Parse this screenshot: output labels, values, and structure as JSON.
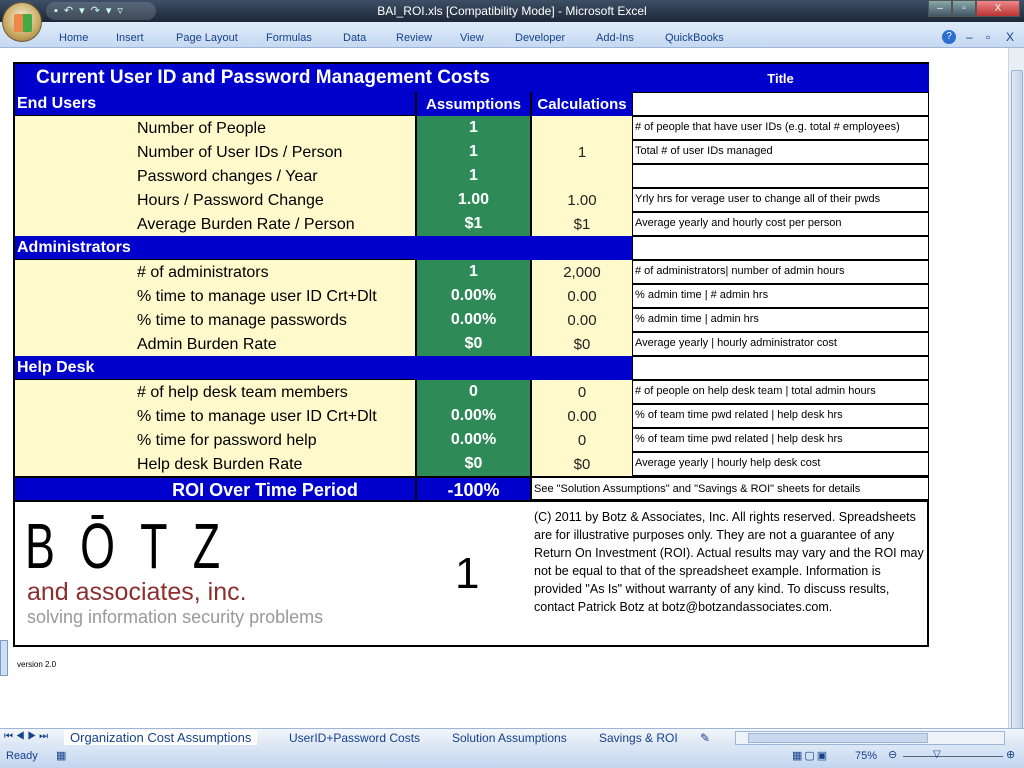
{
  "window": {
    "title": "BAI_ROI.xls  [Compatibility Mode] - Microsoft Excel"
  },
  "ribbon": {
    "tabs": [
      "Home",
      "Insert",
      "Page Layout",
      "Formulas",
      "Data",
      "Review",
      "View",
      "Developer",
      "Add-Ins",
      "QuickBooks"
    ]
  },
  "sheet": {
    "title": "Current User ID and Password Management Costs",
    "title_note": "Title",
    "col_assumptions": "Assumptions",
    "col_calculations": "Calculations",
    "sections": [
      {
        "name": "End Users",
        "rows": [
          {
            "label": "Number of People",
            "assumption": "1",
            "calc": "",
            "note": "# of people that have user IDs (e.g. total # employees)"
          },
          {
            "label": "Number of User IDs / Person",
            "assumption": "1",
            "calc": "1",
            "note": "Total # of user IDs managed"
          },
          {
            "label": "Password changes / Year",
            "assumption": "1",
            "calc": "",
            "note": ""
          },
          {
            "label": "Hours / Password Change",
            "assumption": "1.00",
            "calc": "1.00",
            "note": "Yrly hrs for verage user to change all of their pwds"
          },
          {
            "label": "Average Burden Rate / Person",
            "assumption": "$1",
            "calc": "$1",
            "note": "Average yearly and hourly cost per person"
          }
        ]
      },
      {
        "name": "Administrators",
        "rows": [
          {
            "label": "# of administrators",
            "assumption": "1",
            "calc": "2,000",
            "note": "# of administrators| number of admin hours"
          },
          {
            "label": "% time to manage user ID Crt+Dlt",
            "assumption": "0.00%",
            "calc": "0.00",
            "note": "% admin time |  # admin hrs"
          },
          {
            "label": "% time to manage passwords",
            "assumption": "0.00%",
            "calc": "0.00",
            "note": "% admin time | admin hrs"
          },
          {
            "label": "Admin Burden Rate",
            "assumption": "$0",
            "calc": "$0",
            "note": "Average yearly | hourly administrator cost"
          }
        ]
      },
      {
        "name": "Help Desk",
        "rows": [
          {
            "label": "# of help desk team members",
            "assumption": "0",
            "calc": "0",
            "note": "# of people on help desk team | total admin hours"
          },
          {
            "label": "% time to manage user ID Crt+Dlt",
            "assumption": "0.00%",
            "calc": "0.00",
            "note": "% of team time pwd related | help desk hrs"
          },
          {
            "label": "% time for password help",
            "assumption": "0.00%",
            "calc": "0",
            "note": "% of team time pwd related | help desk hrs"
          },
          {
            "label": "Help desk Burden Rate",
            "assumption": "$0",
            "calc": "$0",
            "note": "Average yearly | hourly help desk cost"
          }
        ]
      }
    ],
    "roi_label": "ROI Over Time Period",
    "roi_value": "-100%",
    "roi_note": "See \"Solution Assumptions\" and \"Savings & ROI\" sheets for details",
    "logo": {
      "name": "BŌTZ",
      "line2": "and associates, inc.",
      "line3": "solving information security problems"
    },
    "big_number": "1",
    "copyright": "(C) 2011 by Botz & Associates, Inc. All rights reserved.  Spreadsheets are for illustrative purposes only.  They are not a guarantee of any Return On Investment (ROI).  Actual results may vary and the ROI may not be equal to that of the spreadsheet example.  Information is provided \"As Is\" without warranty of any kind.  To discuss results, contact Patrick Botz at botz@botzandassociates.com.",
    "version": "version 2.0"
  },
  "sheet_tabs": [
    "Organization Cost Assumptions",
    "UserID+Password Costs",
    "Solution Assumptions",
    "Savings & ROI"
  ],
  "active_sheet": "Organization Cost Assumptions",
  "status": {
    "text": "Ready",
    "zoom": "75%"
  }
}
